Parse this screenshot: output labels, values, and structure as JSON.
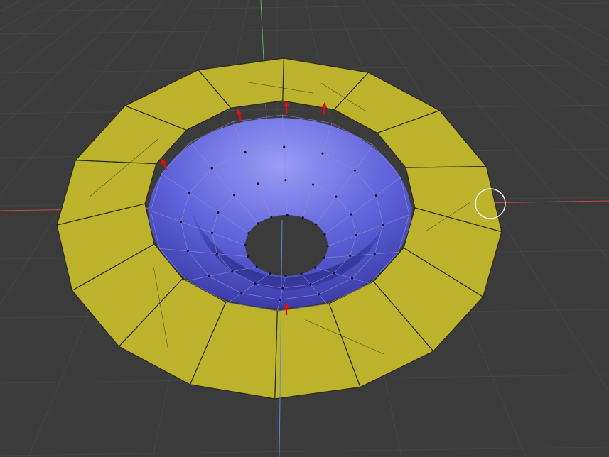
{
  "viewport": {
    "background_color": "#3b3b3b",
    "grid_color": "#454545",
    "axis_x_color": "#c44b4b",
    "axis_y_color": "#5fae6a",
    "axis_z_color": "#5b8ad0"
  },
  "mesh": {
    "selected_faces_color": "#bdb22c",
    "selected_edge_color": "#2b2a12",
    "inner_surface_light": "#9a9cf4",
    "inner_surface_mid": "#6064dc",
    "inner_surface_dark": "#2a2c80",
    "wire_color": "#8c8fd6",
    "vertex_color": "#15153a",
    "normal_arrow_color": "#e01010"
  },
  "cursor": {
    "icon": "brush-circle-cursor-icon",
    "color": "#ffffff"
  }
}
